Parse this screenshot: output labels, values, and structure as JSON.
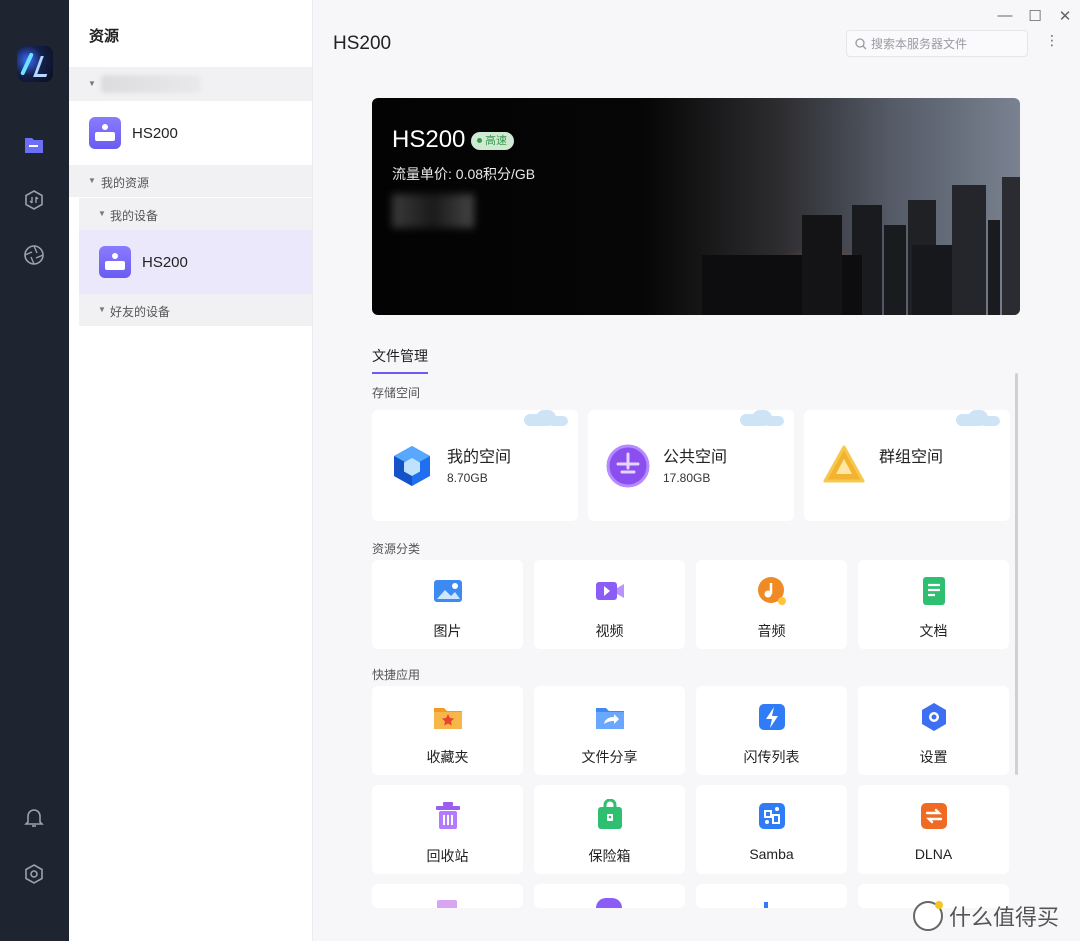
{
  "sidebar": {
    "title": "资源",
    "device_top": "HS200",
    "my_resources": "我的资源",
    "my_devices": "我的设备",
    "device_selected": "HS200",
    "friend_devices": "好友的设备"
  },
  "header": {
    "title": "HS200",
    "search_placeholder": "搜索本服务器文件",
    "more_glyph": "⋮",
    "window_controls": [
      "—",
      "☐",
      "✕"
    ]
  },
  "banner": {
    "name": "HS200",
    "badge": "高速",
    "price": "流量单价: 0.08积分/GB"
  },
  "tab": "文件管理",
  "sections": {
    "storage": "存储空间",
    "categories": "资源分类",
    "quick_apps": "快捷应用"
  },
  "spaces": [
    {
      "name": "我的空间",
      "size": "8.70GB",
      "icon": "cube-icon"
    },
    {
      "name": "公共空间",
      "size": "17.80GB",
      "icon": "sphere-icon"
    },
    {
      "name": "群组空间",
      "size": "",
      "icon": "triangle-icon"
    }
  ],
  "categories": [
    {
      "label": "图片",
      "icon": "image-icon",
      "color": "#3d8bf2"
    },
    {
      "label": "视频",
      "icon": "video-icon",
      "color": "#8b5cf6"
    },
    {
      "label": "音频",
      "icon": "audio-icon",
      "color": "#f08a24"
    },
    {
      "label": "文档",
      "icon": "document-icon",
      "color": "#2fbf71"
    }
  ],
  "apps": [
    {
      "label": "收藏夹",
      "icon": "favorites-folder-icon",
      "color": "#f29a24"
    },
    {
      "label": "文件分享",
      "icon": "share-folder-icon",
      "color": "#3d8bf2"
    },
    {
      "label": "闪传列表",
      "icon": "flash-transfer-icon",
      "color": "#2f7cf6"
    },
    {
      "label": "设置",
      "icon": "settings-icon",
      "color": "#3d6ff2"
    },
    {
      "label": "回收站",
      "icon": "trash-icon",
      "color": "#9b5cf0"
    },
    {
      "label": "保险箱",
      "icon": "safe-icon",
      "color": "#2fbf71"
    },
    {
      "label": "Samba",
      "icon": "samba-icon",
      "color": "#2f7cf6"
    },
    {
      "label": "DLNA",
      "icon": "dlna-icon",
      "color": "#f06a24"
    }
  ],
  "watermark": "什么值得买"
}
